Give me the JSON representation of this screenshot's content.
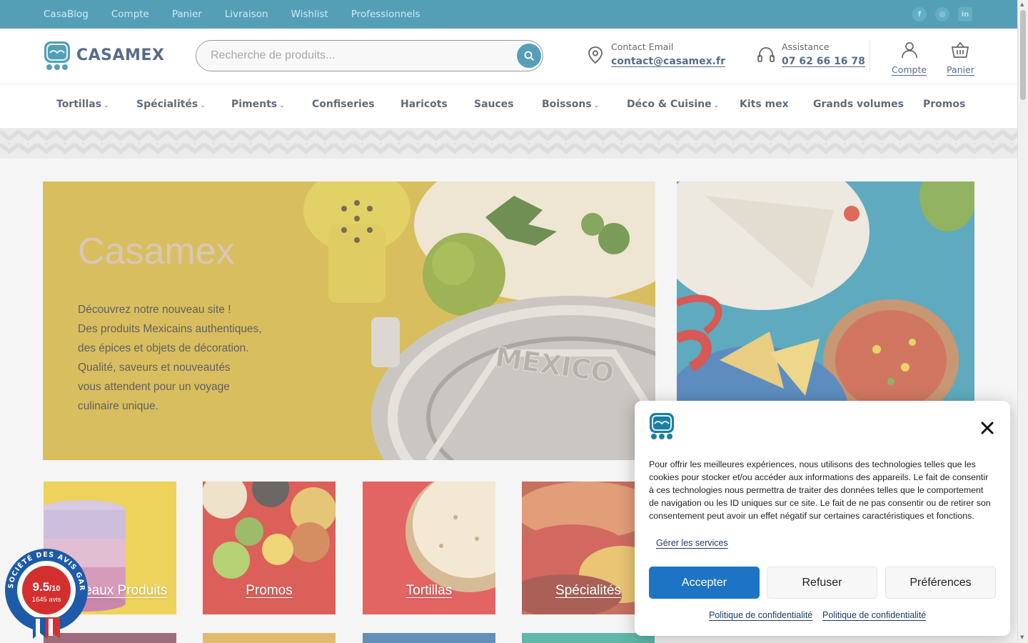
{
  "topbar": {
    "links": [
      "CasaBlog",
      "Compte",
      "Panier",
      "Livraison",
      "Wishlist",
      "Professionnels"
    ],
    "social_icons": [
      "facebook-icon",
      "instagram-icon",
      "linkedin-icon"
    ],
    "background": "#1d7f9e"
  },
  "header": {
    "logo_text": "CASAMEX",
    "search_placeholder": "Recherche de produits...",
    "contact": {
      "label": "Contact Email",
      "value": "contact@casamex.fr"
    },
    "assistance": {
      "label": "Assistance",
      "value": "07 62 66 16 78"
    },
    "account_label": "Compte",
    "cart_label": "Panier"
  },
  "nav": {
    "items": [
      {
        "label": "Tortillas",
        "dropdown": true
      },
      {
        "label": "Spécialités",
        "dropdown": true
      },
      {
        "label": "Piments",
        "dropdown": true
      },
      {
        "label": "Confiseries",
        "dropdown": false
      },
      {
        "label": "Haricots",
        "dropdown": false
      },
      {
        "label": "Sauces",
        "dropdown": false
      },
      {
        "label": "Boissons",
        "dropdown": true
      },
      {
        "label": "Déco & Cuisine",
        "dropdown": true
      },
      {
        "label": "Kits mex",
        "dropdown": false
      },
      {
        "label": "Grands volumes",
        "dropdown": false
      },
      {
        "label": "Promos",
        "dropdown": false
      }
    ]
  },
  "hero": {
    "title": "Casamex",
    "lines": [
      "Découvrez notre nouveau site !",
      "Des produits Mexicains authentiques,",
      "des épices et objets de décoration.",
      "Qualité, saveurs et nouveautés",
      "vous attendent pour un voyage",
      "culinaire unique."
    ],
    "stamp_text": "MEXICO"
  },
  "tiles": [
    {
      "label": "Nouveaux Produits"
    },
    {
      "label": "Promos"
    },
    {
      "label": "Tortillas"
    },
    {
      "label": "Spécialités"
    }
  ],
  "badge": {
    "ring_text": "SOCIÉTÉ DES AVIS GARANTIS",
    "score": "9.5",
    "score_max": "/10",
    "count": "1645 avis"
  },
  "cookie": {
    "message": "Pour offrir les meilleures expériences, nous utilisons des technologies telles que les cookies pour stocker et/ou accéder aux informations des appareils. Le fait de consentir à ces technologies nous permettra de traiter des données telles que le comportement de navigation ou les ID uniques sur ce site. Le fait de ne pas consentir ou de retirer son consentement peut avoir un effet négatif sur certaines caractéristiques et fonctions.",
    "manage_label": "Gérer les services",
    "accept_label": "Accepter",
    "refuse_label": "Refuser",
    "preferences_label": "Préférences",
    "policy_links": [
      "Politique de confidentialité",
      "Politique de confidentialité"
    ],
    "accent": "#1e74c4"
  }
}
